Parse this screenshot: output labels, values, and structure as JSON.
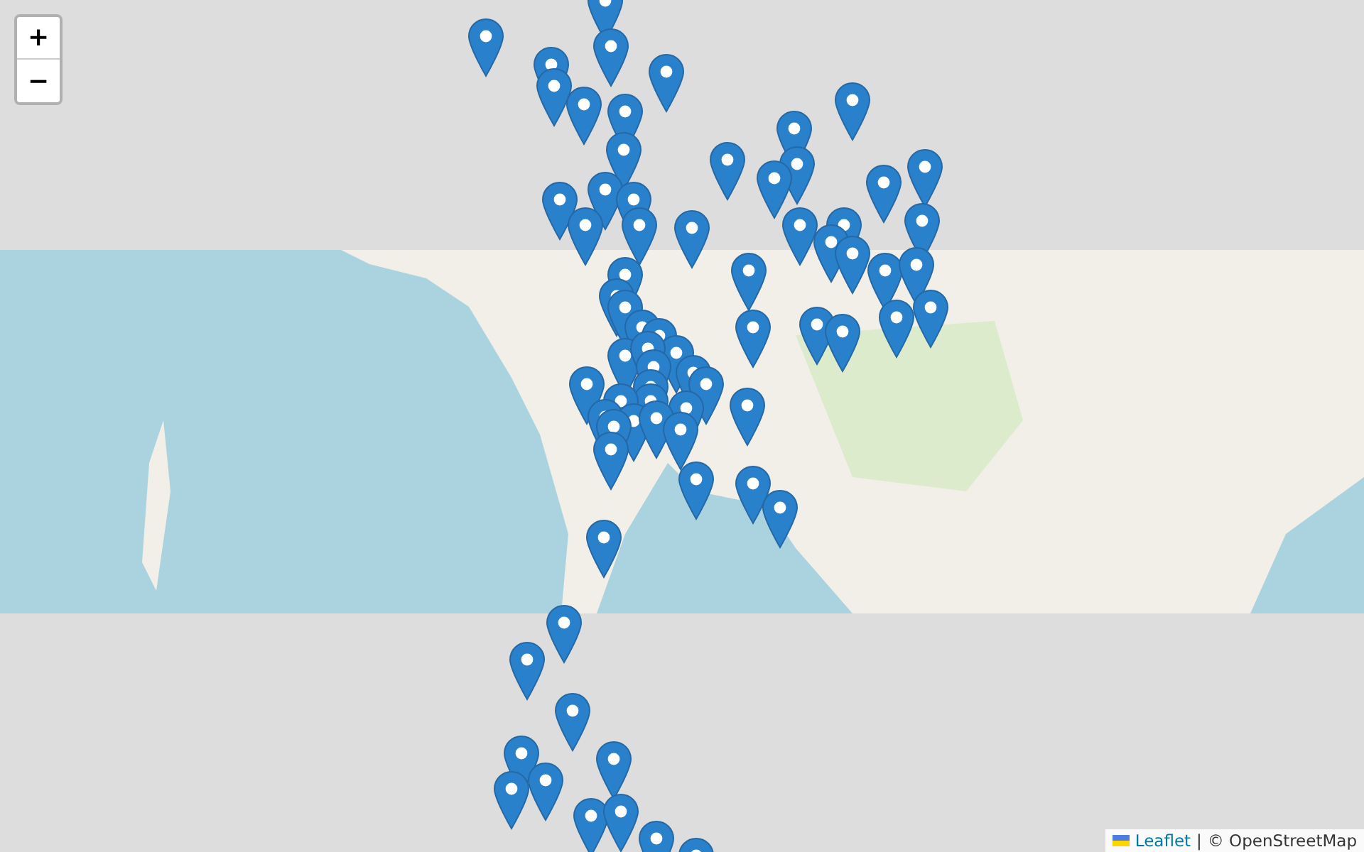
{
  "zoom_control": {
    "zoom_in": "+",
    "zoom_out": "−"
  },
  "attribution": {
    "link": "Leaflet",
    "separator": "|",
    "text": "© OpenStreetMap"
  }
}
